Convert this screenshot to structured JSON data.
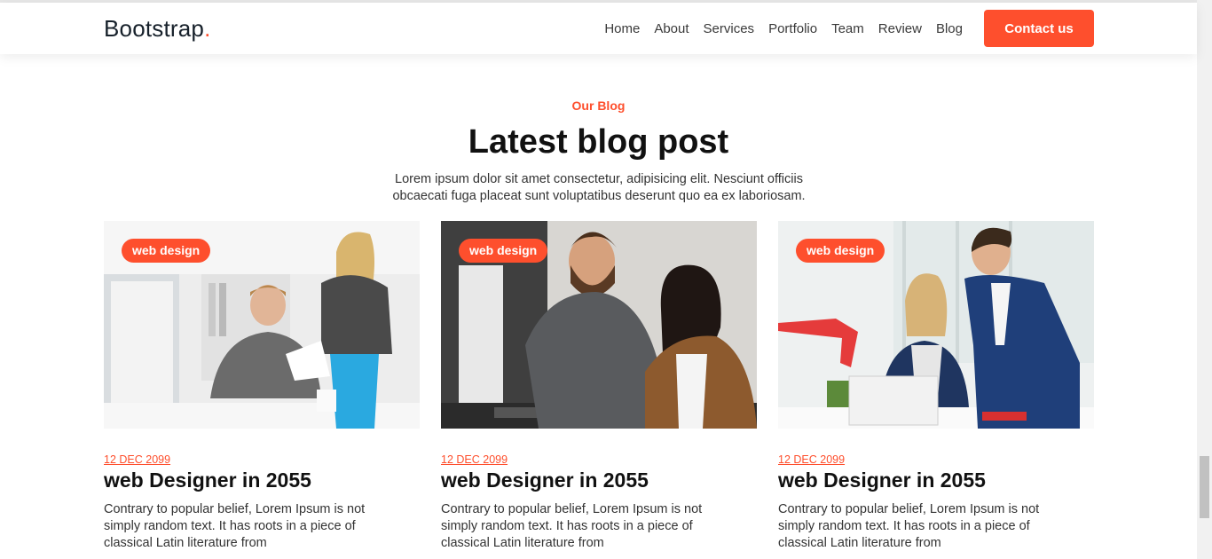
{
  "navbar": {
    "brand": "Bootstrap",
    "brand_dot": ".",
    "links": [
      "Home",
      "About",
      "Services",
      "Portfolio",
      "Team",
      "Review",
      "Blog"
    ],
    "cta": "Contact us"
  },
  "section": {
    "eyebrow": "Our Blog",
    "title": "Latest blog post",
    "description": "Lorem ipsum dolor sit amet consectetur, adipisicing elit. Nesciunt officiis obcaecati fuga placeat sunt voluptatibus deserunt quo ea ex laboriosam."
  },
  "posts": [
    {
      "badge": "web design",
      "date": "12 DEC 2099",
      "title": "web Designer in 2055",
      "excerpt": "Contrary to popular belief, Lorem Ipsum is not simply random text. It has roots in a piece of classical Latin literature from"
    },
    {
      "badge": "web design",
      "date": "12 DEC 2099",
      "title": "web Designer in 2055",
      "excerpt": "Contrary to popular belief, Lorem Ipsum is not simply random text. It has roots in a piece of classical Latin literature from"
    },
    {
      "badge": "web design",
      "date": "12 DEC 2099",
      "title": "web Designer in 2055",
      "excerpt": "Contrary to popular belief, Lorem Ipsum is not simply random text. It has roots in a piece of classical Latin literature from"
    }
  ],
  "colors": {
    "accent": "#fe4f2d",
    "text_dark": "#111111"
  }
}
